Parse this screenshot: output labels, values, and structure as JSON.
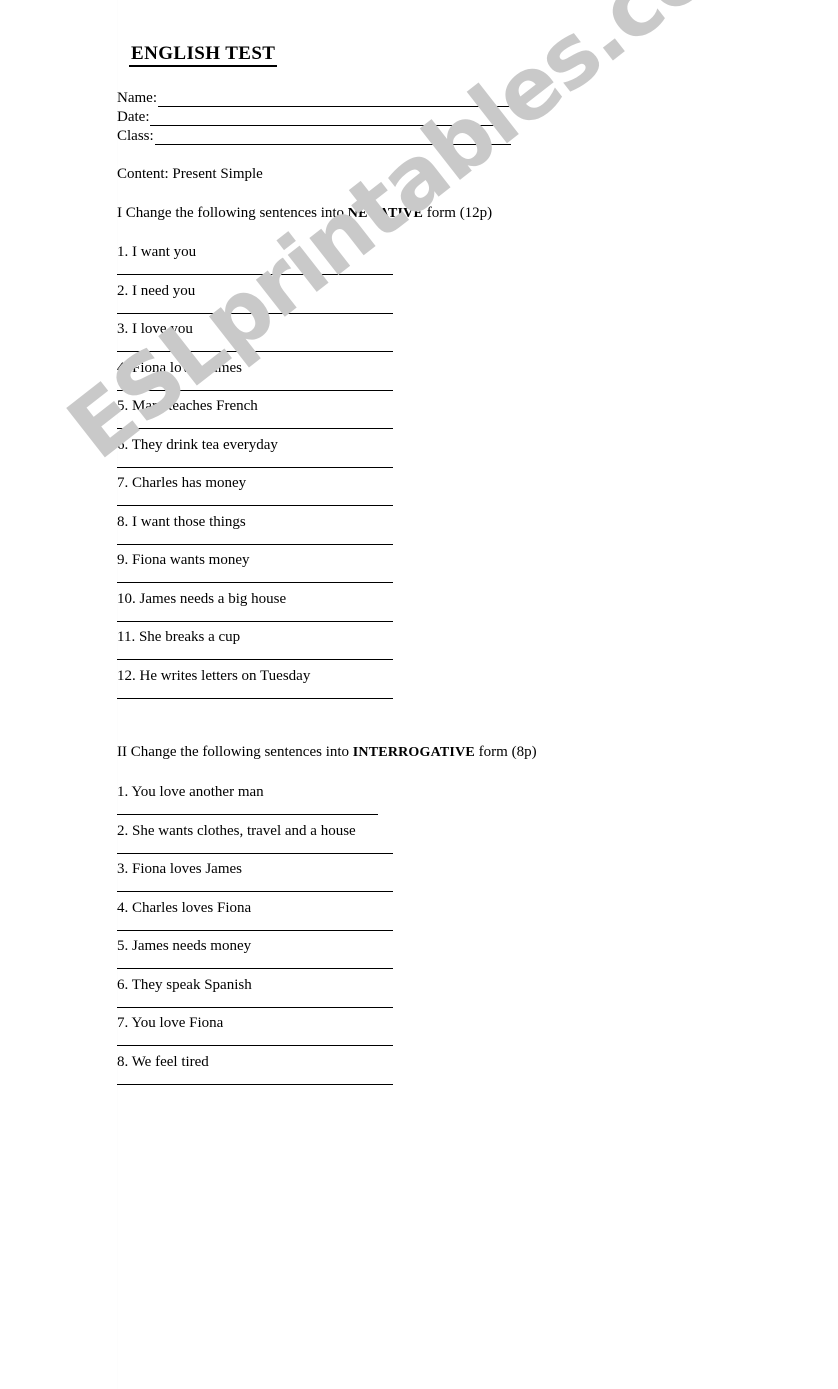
{
  "document": {
    "title": "ENGLISH TEST",
    "watermark": "ESLprintables.com",
    "watermark_color": "#c9c9c9",
    "text_color": "#000000",
    "background_color": "#ffffff"
  },
  "identity": {
    "rows": [
      {
        "label": "Name:"
      },
      {
        "label": "Date:"
      },
      {
        "label": "Class:"
      }
    ]
  },
  "content_note": "Content: Present Simple",
  "sections": [
    {
      "heading_prefix": "I Change the following sentences into ",
      "heading_emphasis": "NEGATIVE",
      "heading_suffix": " form (12p)",
      "items": [
        "1. I want you",
        "2. I need you",
        "3. I love you",
        "4. Fiona loves James",
        "5. Mary teaches French",
        "6. They drink tea everyday",
        "7. Charles has money",
        "8. I want those things",
        "9. Fiona wants money",
        "10. James needs a big house",
        "11. She breaks a cup",
        "12. He writes letters on Tuesday"
      ]
    },
    {
      "heading_prefix": "II Change the following sentences into ",
      "heading_emphasis": "INTERROGATIVE",
      "heading_suffix": " form (8p)",
      "items": [
        "1. You love another man",
        "2. She wants clothes, travel and a house",
        "3. Fiona loves James",
        "4. Charles loves Fiona",
        "5. James needs money",
        "6. They speak Spanish",
        "7. You love Fiona",
        "8. We feel tired"
      ]
    }
  ]
}
